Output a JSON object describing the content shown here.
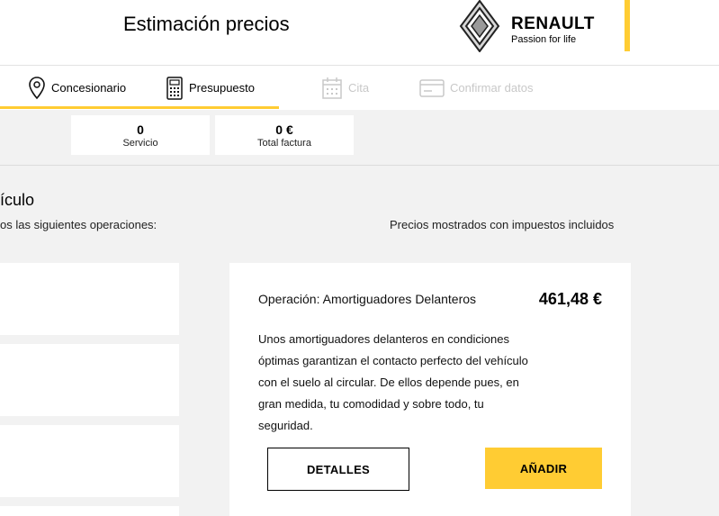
{
  "header": {
    "title": "Estimación precios",
    "brand": {
      "name": "RENAULT",
      "tagline": "Passion for life"
    },
    "accent": "#ffcc33"
  },
  "steps": [
    {
      "label": "Concesionario",
      "icon": "location-pin-icon",
      "state": "done"
    },
    {
      "label": "Presupuesto",
      "icon": "calculator-icon",
      "state": "active"
    },
    {
      "label": "Cita",
      "icon": "calendar-icon",
      "state": "disabled"
    },
    {
      "label": "Confirmar datos",
      "icon": "card-icon",
      "state": "disabled"
    }
  ],
  "summary": [
    {
      "value": "0",
      "label": "Servicio"
    },
    {
      "value": "0 €",
      "label": "Total factura"
    }
  ],
  "section": {
    "title": "ículo",
    "subtitle": "os las siguientes operaciones:",
    "price_note": "Precios mostrados con impuestos incluidos"
  },
  "operation": {
    "title": "Operación: Amortiguadores Delanteros",
    "price": "461,48 €",
    "description": "Unos amortiguadores delanteros en condiciones óptimas garantizan el contacto perfecto del vehículo con el suelo al circular. De ellos depende pues, en gran medida, tu comodidad y sobre todo, tu seguridad.",
    "details_label": "DETALLES",
    "add_label": "AÑADIR"
  }
}
